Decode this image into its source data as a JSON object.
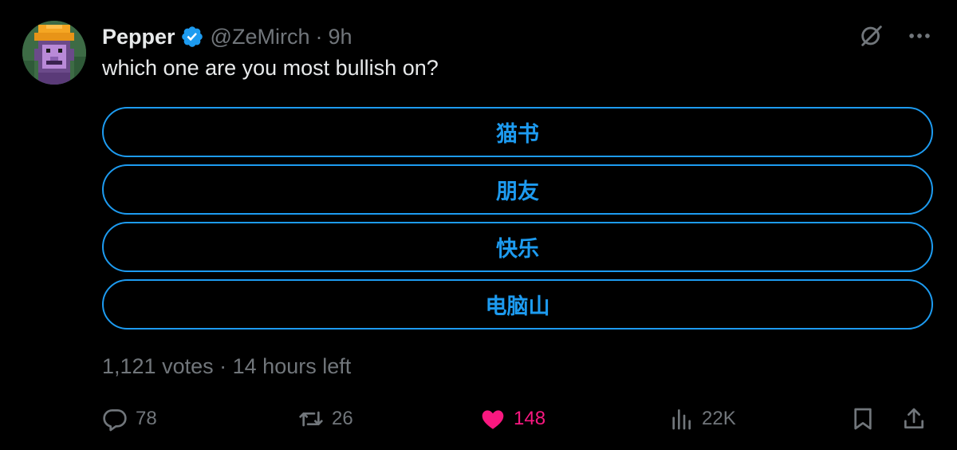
{
  "author": {
    "display_name": "Pepper",
    "handle": "@ZeMirch",
    "separator": "·",
    "time": "9h"
  },
  "tweet": {
    "text": "which one are you most bullish on?"
  },
  "poll": {
    "options": [
      {
        "label": "猫书"
      },
      {
        "label": "朋友"
      },
      {
        "label": "快乐"
      },
      {
        "label": "电脑山"
      }
    ],
    "votes": "1,121 votes",
    "separator": "·",
    "time_left": "14 hours left"
  },
  "actions": {
    "replies": "78",
    "reposts": "26",
    "likes": "148",
    "views": "22K"
  },
  "icons": {
    "verified": "verified-badge-icon",
    "grok": "grok-icon",
    "more": "more-icon",
    "reply": "reply-icon",
    "repost": "repost-icon",
    "like": "heart-icon",
    "views": "views-icon",
    "bookmark": "bookmark-icon",
    "share": "share-icon"
  },
  "colors": {
    "background": "#000000",
    "text": "#e7e9ea",
    "muted": "#71767b",
    "accent": "#1d9bf0",
    "like": "#f91880"
  }
}
